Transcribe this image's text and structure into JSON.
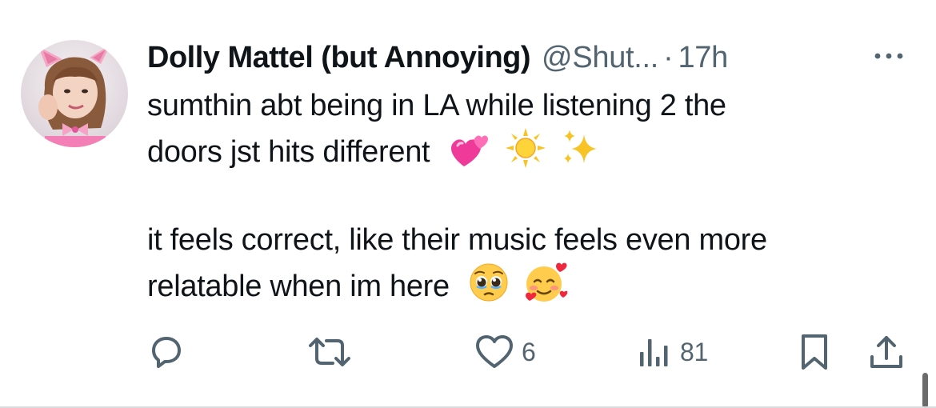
{
  "tweet": {
    "display_name": "Dolly Mattel (but Annoying)",
    "handle": "@Shut...",
    "separator": "·",
    "time": "17h",
    "text_line_1": "sumthin abt being in LA while listening 2 the",
    "text_line_2": "doors jst hits different",
    "text_line_3": "it feels correct, like their music feels even more",
    "text_line_4": "relatable when im here",
    "emojis_line_2": [
      "two-hearts-emoji",
      "sun-emoji",
      "sparkles-emoji"
    ],
    "emojis_line_4": [
      "pleading-face-emoji",
      "smiling-face-with-hearts-emoji"
    ]
  },
  "actions": {
    "reply_icon": "reply-icon",
    "retweet_icon": "retweet-icon",
    "like_icon": "heart-icon",
    "like_count": "6",
    "views_icon": "views-icon",
    "views_count": "81",
    "bookmark_icon": "bookmark-icon",
    "share_icon": "share-icon"
  },
  "colors": {
    "text_primary": "#0f1419",
    "text_secondary": "#536471",
    "background": "#ffffff"
  }
}
